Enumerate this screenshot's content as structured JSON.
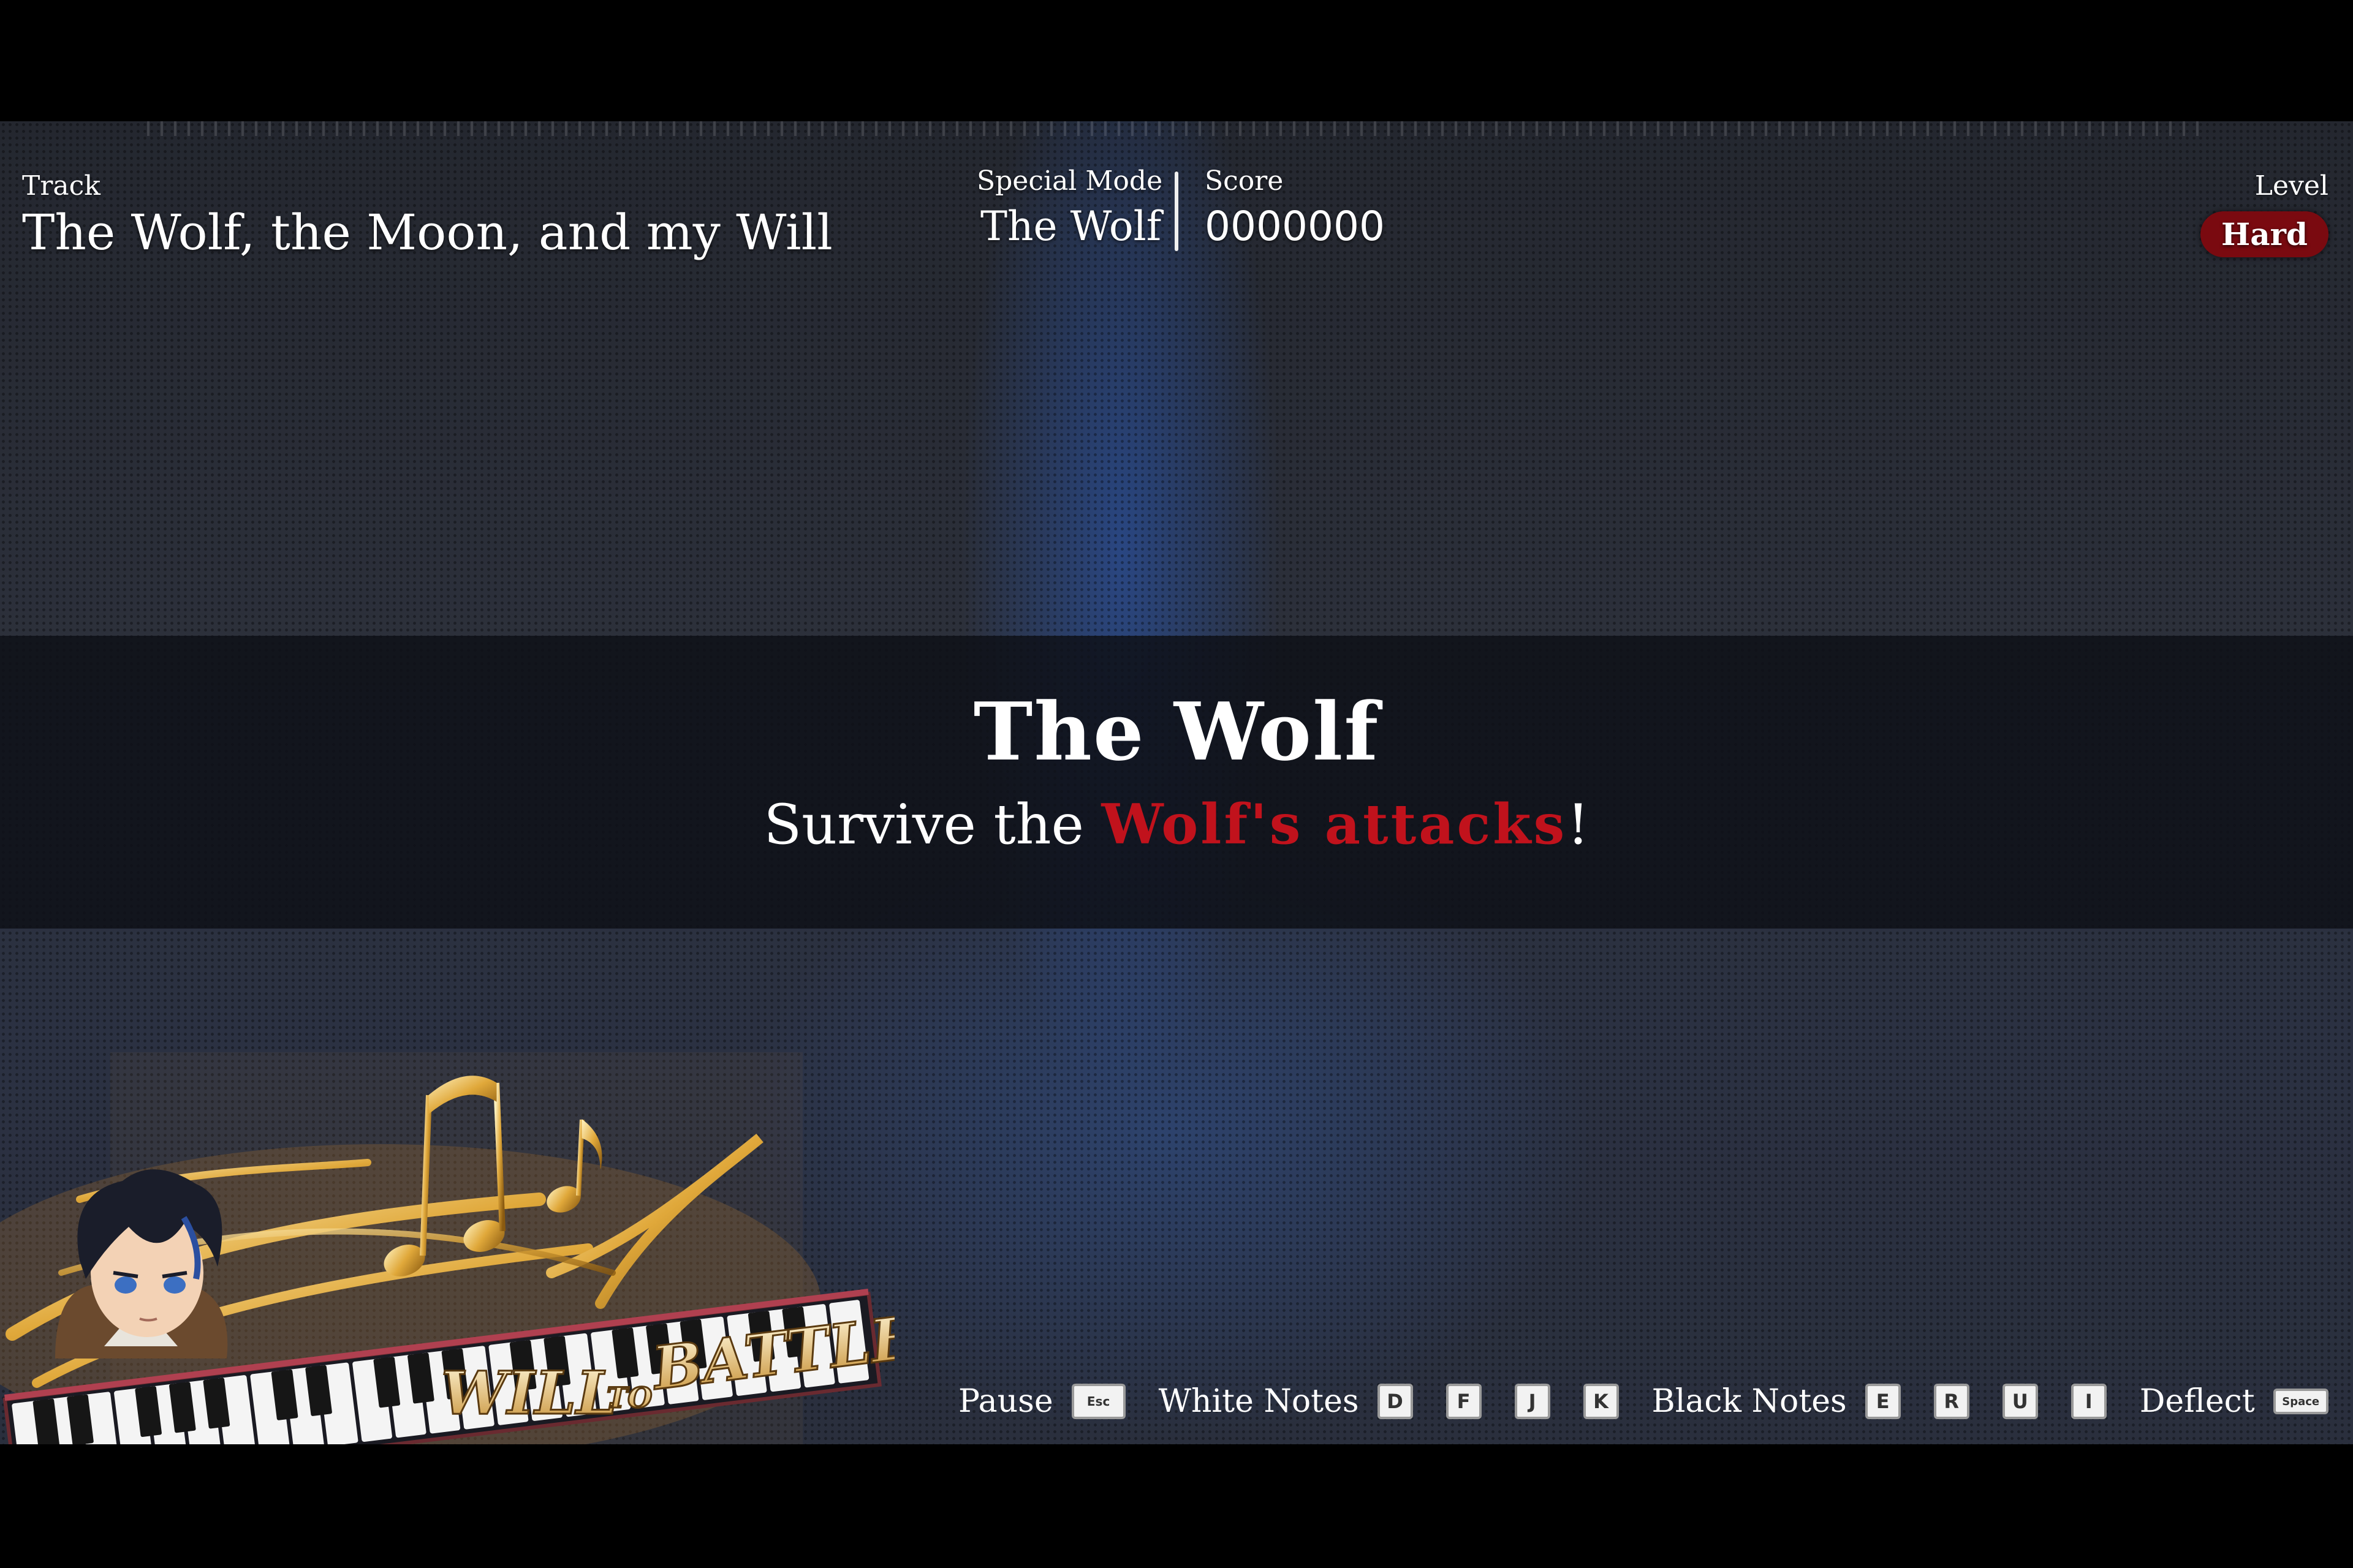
{
  "track": {
    "label": "Track",
    "title": "The Wolf, the Moon, and my Will"
  },
  "special_mode": {
    "label": "Special Mode",
    "value": "The Wolf"
  },
  "score": {
    "label": "Score",
    "value": "0000000"
  },
  "level": {
    "label": "Level",
    "value": "Hard"
  },
  "banner": {
    "title": "The Wolf",
    "subtitle_prefix": "Survive the ",
    "subtitle_highlight": "Wolf's attacks",
    "subtitle_suffix": "!"
  },
  "logo": {
    "text_will": "WILL",
    "text_to": "TO",
    "text_battle": "BATTLE"
  },
  "controls": {
    "pause": {
      "label": "Pause",
      "key": "Esc"
    },
    "white_notes": {
      "label": "White Notes",
      "keys": [
        "D",
        "F",
        "J",
        "K"
      ]
    },
    "black_notes": {
      "label": "Black Notes",
      "keys": [
        "E",
        "R",
        "U",
        "I"
      ]
    },
    "deflect": {
      "label": "Deflect",
      "key": "Space"
    }
  },
  "colors": {
    "accent_red": "#c1121c",
    "level_badge": "#7a0a10"
  }
}
